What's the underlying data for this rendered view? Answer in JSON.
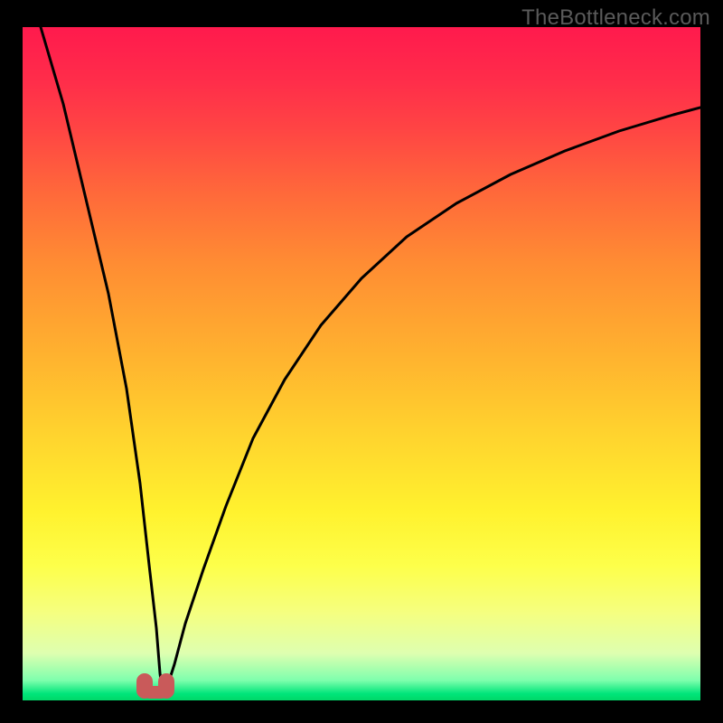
{
  "watermark": "TheBottleneck.com",
  "chart_data": {
    "type": "line",
    "title": "",
    "xlabel": "",
    "ylabel": "",
    "xlim": [
      0,
      100
    ],
    "ylim": [
      0,
      100
    ],
    "background_gradient": {
      "top": "#ff1a4d",
      "bottom": "#00d868",
      "stops": [
        "red",
        "orange",
        "yellow",
        "green"
      ]
    },
    "series": [
      {
        "name": "bottleneck-curve",
        "color": "#000000",
        "x": [
          0,
          2,
          5,
          8,
          11,
          14,
          16,
          18,
          19,
          20,
          21,
          22,
          24,
          27,
          30,
          34,
          38,
          43,
          48,
          54,
          60,
          67,
          74,
          82,
          90,
          100
        ],
        "y": [
          100,
          88,
          74,
          60,
          46,
          32,
          20,
          9,
          4,
          1,
          2,
          4,
          9,
          19,
          29,
          39,
          48,
          56,
          63,
          69,
          74,
          78,
          82,
          85,
          87,
          89
        ]
      }
    ],
    "marker": {
      "name": "min-indicator",
      "color": "#c95a5a",
      "x": 20,
      "y": 1,
      "shape": "u"
    }
  }
}
